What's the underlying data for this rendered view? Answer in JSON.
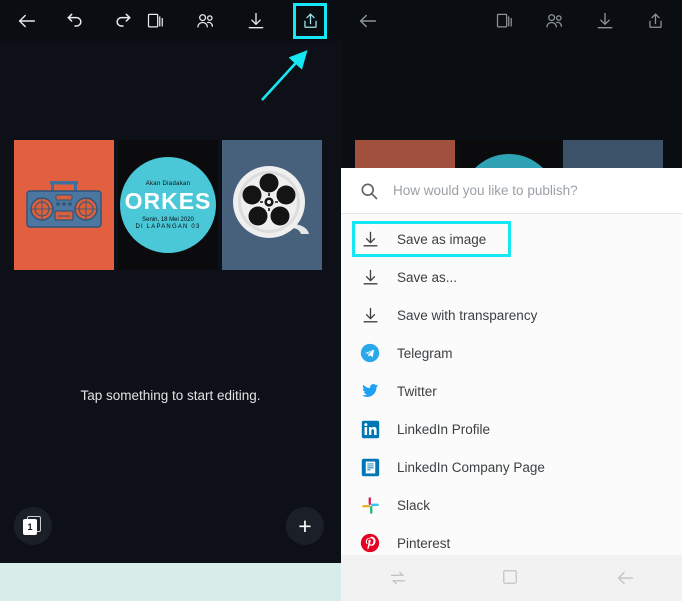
{
  "left_screen": {
    "toolbar": {
      "back_label": "back-arrow",
      "undo_label": "undo",
      "redo_label": "redo",
      "pages_label": "pages",
      "collaborators_label": "collaborators",
      "download_label": "download",
      "share_label": "share",
      "highlight_color": "#16e7f5"
    },
    "annotation": {
      "arrow_color": "#16e7f5"
    },
    "artboards": [
      {
        "name": "boombox-artboard",
        "bg": "#e2603f",
        "accent": "#3f6f9c"
      },
      {
        "name": "orkes-artboard",
        "bg": "#0b0b0d",
        "circle_color": "#4ac8d8",
        "line1": "Akan Diadakan",
        "title": "ORKES",
        "line2": "Senin, 18 Mei 2020",
        "line3": "DI LAPANGAN 03"
      },
      {
        "name": "film-reel-artboard",
        "bg": "#47617c",
        "reel_color": "#e7e7e7"
      }
    ],
    "hint_text": "Tap something to start editing.",
    "page_counter": "1",
    "add_button_label": "+",
    "bottom_strip_color": "#d8edea"
  },
  "right_screen": {
    "toolbar": {
      "back_label": "back-arrow",
      "pages_label": "pages",
      "collaborators_label": "collaborators",
      "download_label": "download",
      "share_label": "share"
    },
    "artboards": [
      {
        "name": "boombox-artboard-dim",
        "bg": "#a0503c"
      },
      {
        "name": "orkes-artboard-dim",
        "bg": "#0b0b0d",
        "circle_color": "#2fa3b5"
      },
      {
        "name": "film-reel-artboard-dim",
        "bg": "#3c5268"
      }
    ],
    "search": {
      "placeholder": "How would you like to publish?",
      "value": ""
    },
    "publish_options": [
      {
        "label": "Save as image",
        "icon": "download-icon",
        "icon_color": "#3c4043",
        "highlighted": true
      },
      {
        "label": "Save as...",
        "icon": "download-icon",
        "icon_color": "#3c4043",
        "highlighted": false
      },
      {
        "label": "Save with transparency",
        "icon": "download-icon",
        "icon_color": "#3c4043",
        "highlighted": false
      },
      {
        "label": "Telegram",
        "icon": "telegram-icon",
        "icon_color": "#29a9e9",
        "highlighted": false
      },
      {
        "label": "Twitter",
        "icon": "twitter-icon",
        "icon_color": "#1da1f2",
        "highlighted": false
      },
      {
        "label": "LinkedIn Profile",
        "icon": "linkedin-icon",
        "icon_color": "#0077b5",
        "highlighted": false
      },
      {
        "label": "LinkedIn Company Page",
        "icon": "linkedin-company-icon",
        "icon_color": "#0077b5",
        "highlighted": false
      },
      {
        "label": "Slack",
        "icon": "slack-icon",
        "icon_color": "#e01e5a",
        "highlighted": false
      },
      {
        "label": "Pinterest",
        "icon": "pinterest-icon",
        "icon_color": "#e60023",
        "highlighted": false
      }
    ],
    "highlight_color": "#16e7f5",
    "navbar": {
      "recents_label": "recents",
      "home_label": "home",
      "back_label": "back"
    }
  }
}
